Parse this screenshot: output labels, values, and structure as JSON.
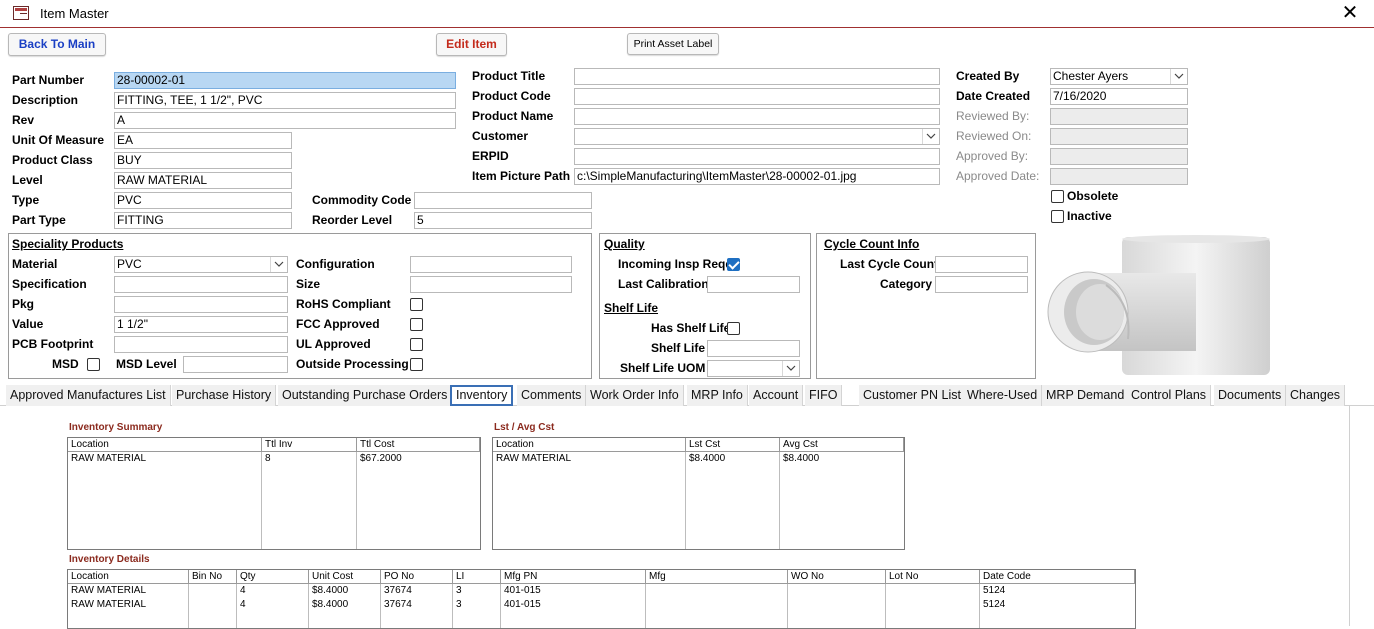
{
  "window": {
    "title": "Item Master",
    "close": "✕"
  },
  "buttons": {
    "back": "Back To Main",
    "edit": "Edit Item",
    "print": "Print Asset Label"
  },
  "colors": {
    "link_blue": "#1a3fc4",
    "edit_red": "#c42b1c",
    "subtitle_red": "#8b2a1e",
    "check_blue": "#1e6fc2"
  },
  "main": {
    "part_number": {
      "label": "Part Number",
      "value": "28-00002-01"
    },
    "description": {
      "label": "Description",
      "value": "FITTING, TEE, 1 1/2\", PVC"
    },
    "rev": {
      "label": "Rev",
      "value": "A"
    },
    "uom": {
      "label": "Unit Of Measure",
      "value": "EA"
    },
    "product_class": {
      "label": "Product Class",
      "value": "BUY"
    },
    "level": {
      "label": "Level",
      "value": "RAW MATERIAL"
    },
    "type": {
      "label": "Type",
      "value": "PVC"
    },
    "part_type": {
      "label": "Part Type",
      "value": "FITTING"
    },
    "commodity_code": {
      "label": "Commodity Code",
      "value": ""
    },
    "reorder_level": {
      "label": "Reorder Level",
      "value": "5"
    }
  },
  "product": {
    "title": {
      "label": "Product Title",
      "value": ""
    },
    "code": {
      "label": "Product Code",
      "value": ""
    },
    "name": {
      "label": "Product Name",
      "value": ""
    },
    "customer": {
      "label": "Customer",
      "value": ""
    },
    "erpid": {
      "label": "ERPID",
      "value": ""
    },
    "picture_path": {
      "label": "Item Picture Path",
      "value": "c:\\SimpleManufacturing\\ItemMaster\\28-00002-01.jpg"
    }
  },
  "audit": {
    "created_by": {
      "label": "Created By",
      "value": "Chester Ayers"
    },
    "date_created": {
      "label": "Date Created",
      "value": "7/16/2020"
    },
    "reviewed_by": {
      "label": "Reviewed By:",
      "value": ""
    },
    "reviewed_on": {
      "label": "Reviewed On:",
      "value": ""
    },
    "approved_by": {
      "label": "Approved By:",
      "value": ""
    },
    "approved_date": {
      "label": "Approved Date:",
      "value": ""
    },
    "obsolete": {
      "label": "Obsolete",
      "checked": false
    },
    "inactive": {
      "label": "Inactive",
      "checked": false
    }
  },
  "speciality": {
    "heading": "Speciality Products",
    "material": {
      "label": "Material",
      "value": "PVC"
    },
    "specification": {
      "label": "Specification",
      "value": ""
    },
    "pkg": {
      "label": "Pkg",
      "value": ""
    },
    "value": {
      "label": "Value",
      "value": "1 1/2\""
    },
    "pcb_footprint": {
      "label": "PCB Footprint",
      "value": ""
    },
    "msd": {
      "label": "MSD",
      "checked": false
    },
    "msd_level": {
      "label": "MSD Level",
      "value": ""
    },
    "configuration": {
      "label": "Configuration",
      "value": ""
    },
    "size": {
      "label": "Size",
      "value": ""
    },
    "rohs": {
      "label": "RoHS Compliant",
      "checked": false
    },
    "fcc": {
      "label": "FCC Approved",
      "checked": false
    },
    "ul": {
      "label": "UL Approved",
      "checked": false
    },
    "outside_processing": {
      "label": "Outside Processing",
      "checked": false
    }
  },
  "quality": {
    "heading": "Quality",
    "incoming_insp": {
      "label": "Incoming Insp Reqd",
      "checked": true
    },
    "last_calibration": {
      "label": "Last Calibration",
      "value": ""
    },
    "shelf_heading": "Shelf Life",
    "has_shelf_life": {
      "label": "Has Shelf Life",
      "checked": false
    },
    "shelf_life": {
      "label": "Shelf Life",
      "value": ""
    },
    "shelf_life_uom": {
      "label": "Shelf Life UOM",
      "value": ""
    }
  },
  "cycle": {
    "heading": "Cycle Count Info",
    "last_cycle_count": {
      "label": "Last Cycle Count",
      "value": ""
    },
    "category": {
      "label": "Category",
      "value": ""
    }
  },
  "tabs": [
    "Approved Manufactures List",
    "Purchase History",
    "Outstanding Purchase Orders",
    "Inventory",
    "Comments",
    "Work Order Info",
    "MRP Info",
    "Account",
    "FIFO",
    "Customer PN List",
    "Where-Used",
    "MRP Demand",
    "Control Plans",
    "Documents",
    "Changes"
  ],
  "active_tab": "Inventory",
  "inventory_summary": {
    "title": "Inventory Summary",
    "columns": [
      "Location",
      "Ttl Inv",
      "Ttl Cost"
    ],
    "rows": [
      [
        "RAW MATERIAL",
        "8",
        "$67.2000"
      ]
    ]
  },
  "lst_avg": {
    "title": "Lst / Avg Cst",
    "columns": [
      "Location",
      "Lst Cst",
      "Avg Cst"
    ],
    "rows": [
      [
        "RAW MATERIAL",
        "$8.4000",
        "$8.4000"
      ]
    ]
  },
  "inventory_details": {
    "title": "Inventory Details",
    "columns": [
      "Location",
      "Bin No",
      "Qty",
      "Unit Cost",
      "PO No",
      "LI",
      "Mfg PN",
      "Mfg",
      "WO No",
      "Lot No",
      "Date Code"
    ],
    "rows": [
      [
        "RAW MATERIAL",
        "",
        "4",
        "$8.4000",
        "37674",
        "3",
        "401-015",
        "",
        "",
        "",
        "5124"
      ],
      [
        "RAW MATERIAL",
        "",
        "4",
        "$8.4000",
        "37674",
        "3",
        "401-015",
        "",
        "",
        "",
        "5124"
      ]
    ]
  }
}
